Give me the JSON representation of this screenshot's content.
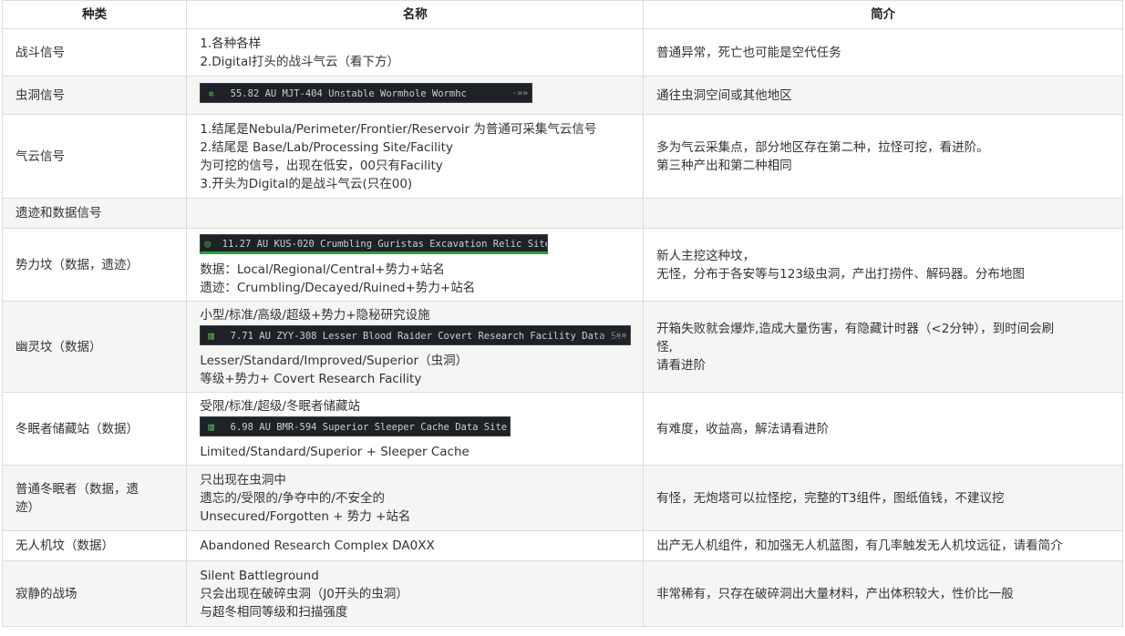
{
  "headers": [
    "种类",
    "名称",
    "简介"
  ],
  "rows": [
    {
      "type": "战斗信号",
      "name_lines": [
        "1.各种各样",
        "2.Digital打头的战斗气云（看下方）"
      ],
      "desc_lines": [
        "普通异常，死亡也可能是空代任务"
      ]
    },
    {
      "type": "虫洞信号",
      "banner": {
        "icon": "wormhole-icon",
        "glyph": "✲",
        "text": "55.82 AU  MJT-404  Unstable Wormhole  Wormhc",
        "arrow": "-»»"
      },
      "desc_lines": [
        "通往虫洞空间或其他地区"
      ]
    },
    {
      "type": "气云信号",
      "name_lines": [
        "1.结尾是Nebula/Perimeter/Frontier/Reservoir 为普通可采集气云信号",
        "2.结尾是 Base/Lab/Processing Site/Facility",
        "为可挖的信号，出现在低安，00只有Facility",
        "3.开头为Digital的是战斗气云(只在00)"
      ],
      "desc_lines": [
        "多为气云采集点，部分地区存在第二种，拉怪可挖，看进阶。",
        "第三种产出和第二种相同"
      ]
    },
    {
      "type": "遗迹和数据信号",
      "name_lines": [],
      "desc_lines": []
    },
    {
      "type": "势力坟（数据，遗迹）",
      "banner": {
        "icon": "relic-site-icon",
        "glyph": "◎",
        "text": "11.27 AU  KUS-020  Crumbling Guristas Excavation    Relic Site",
        "arrow": ""
      },
      "name_lines_after": [
        "数据：Local/Regional/Central+势力+站名",
        "遗迹：Crumbling/Decayed/Ruined+势力+站名"
      ],
      "desc_lines": [
        "新人主挖这种坟，",
        "无怪，分布于各安等与123级虫洞，产出打捞件、解码器。分布地图"
      ]
    },
    {
      "type": "幽灵坟（数据）",
      "name_lines_before": [
        "小型/标准/高级/超级+势力+隐秘研究设施"
      ],
      "banner": {
        "icon": "data-site-icon",
        "glyph": "▥",
        "text": "7.71 AU  ZYY-308  Lesser Blood Raider Covert Research Facility Data Sit",
        "arrow": "-»»"
      },
      "name_lines_after": [
        "Lesser/Standard/Improved/Superior（虫洞）",
        "等级+势力+ Covert Research Facility"
      ],
      "desc_lines": [
        "开箱失败就会爆炸,造成大量伤害，有隐藏计时器（<2分钟），到时间会刷",
        "怪,",
        "请看进阶"
      ]
    },
    {
      "type": "冬眠者储藏站（数据）",
      "name_lines_before": [
        "受限/标准/超级/冬眠者储藏站"
      ],
      "banner": {
        "icon": "data-site-icon",
        "glyph": "▥",
        "text": "6.98 AU  BMR-594  Superior Sleeper Cache    Data Site",
        "arrow": ""
      },
      "name_lines_after": [
        "Limited/Standard/Superior + Sleeper Cache"
      ],
      "desc_lines": [
        "有难度，收益高，解法请看进阶"
      ]
    },
    {
      "type_lines": [
        "普通冬眠者（数据，遗",
        "迹）"
      ],
      "name_lines": [
        "只出现在虫洞中",
        "遗忘的/受限的/争夺中的/不安全的",
        "Unsecured/Forgotten + 势力 +站名"
      ],
      "desc_lines": [
        "有怪，无炮塔可以拉怪挖，完整的T3组件，图纸值钱，不建议挖"
      ]
    },
    {
      "type": "无人机坟（数据）",
      "name_lines": [
        "Abandoned Research Complex DA0XX"
      ],
      "desc_lines": [
        "出产无人机组件，和加强无人机蓝图，有几率触发无人机坟远征，请看简介"
      ]
    },
    {
      "type": "寂静的战场",
      "name_lines": [
        "Silent Battleground",
        "只会出现在破碎虫洞（J0开头的虫洞）",
        "与超冬相同等级和扫描强度"
      ],
      "desc_lines": [
        "非常稀有，只存在破碎洞出大量材料，产出体积较大，性价比一般"
      ]
    }
  ]
}
